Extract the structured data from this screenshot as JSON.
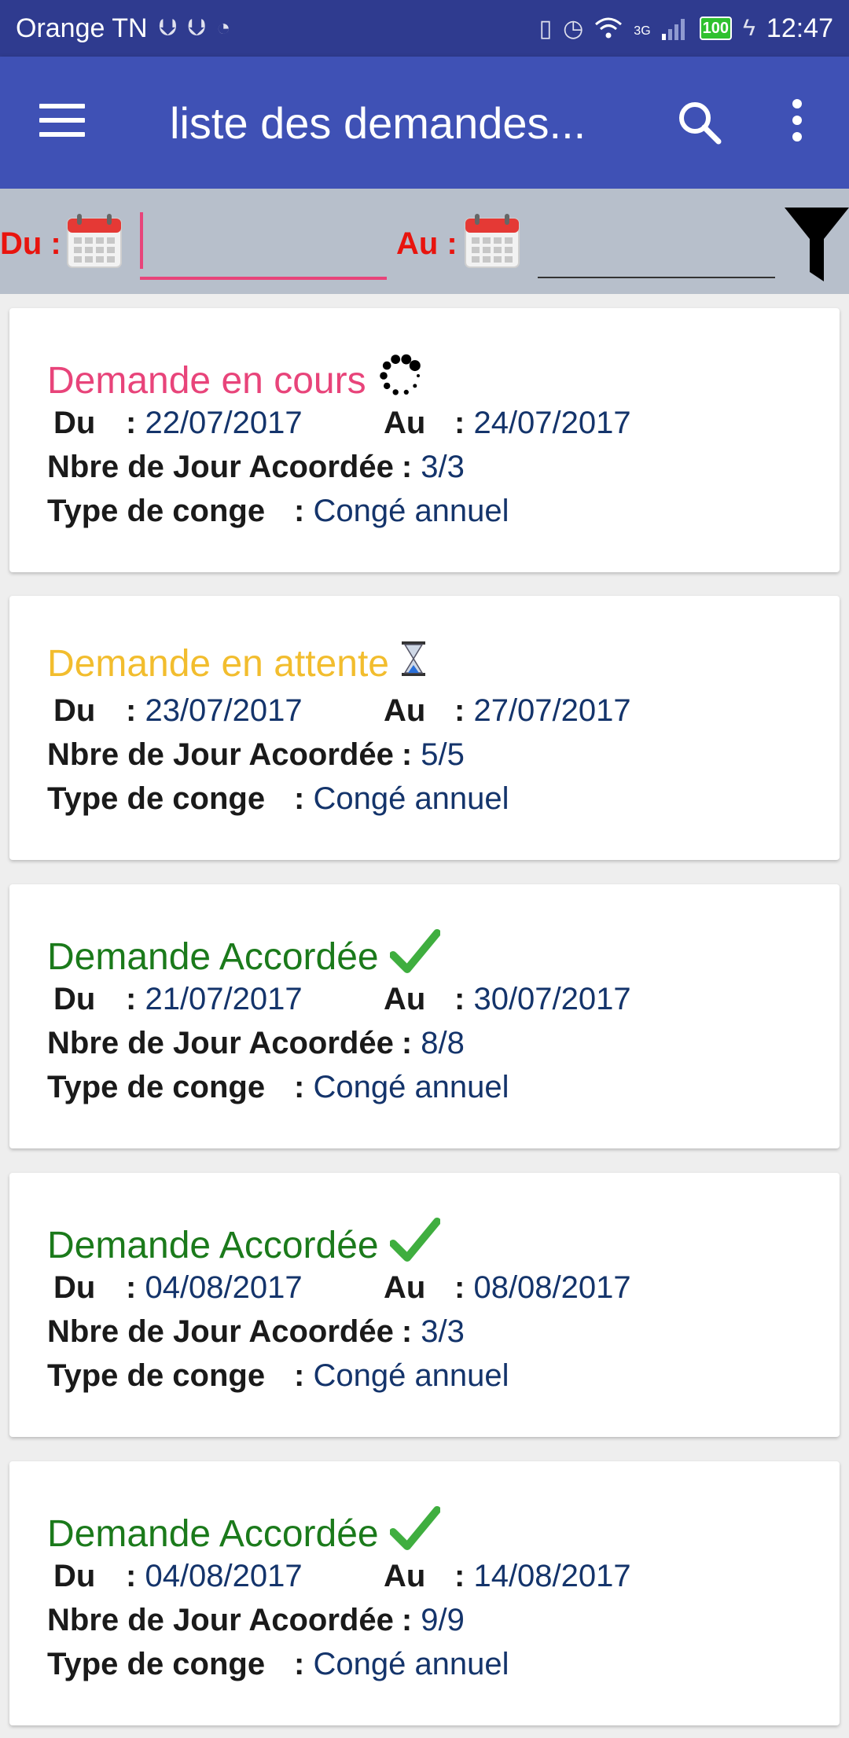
{
  "status_bar": {
    "carrier": "Orange TN",
    "network": "3G",
    "battery": "100",
    "time": "12:47"
  },
  "app_bar": {
    "title": "liste des demandes..."
  },
  "filter": {
    "from_label": "Du :",
    "to_label": "Au :",
    "from_value": "",
    "to_value": ""
  },
  "labels": {
    "du": "Du",
    "au": "Au",
    "colon": ":",
    "nbre": "Nbre de Jour Acoordée",
    "type": "Type de conge"
  },
  "requests": [
    {
      "status": "Demande en cours",
      "status_icon": "loading-spinner-icon",
      "status_color": "#e8447a",
      "du": "22/07/2017",
      "au": "24/07/2017",
      "jours": "3/3",
      "type": "Congé annuel"
    },
    {
      "status": "Demande en attente",
      "status_icon": "hourglass-icon",
      "status_color": "#f2bd2e",
      "du": "23/07/2017",
      "au": "27/07/2017",
      "jours": "5/5",
      "type": "Congé annuel"
    },
    {
      "status": "Demande Accordée",
      "status_icon": "checkmark-icon",
      "status_color": "#1b7a1b",
      "du": "21/07/2017",
      "au": "30/07/2017",
      "jours": "8/8",
      "type": "Congé annuel"
    },
    {
      "status": "Demande Accordée",
      "status_icon": "checkmark-icon",
      "status_color": "#1b7a1b",
      "du": "04/08/2017",
      "au": "08/08/2017",
      "jours": "3/3",
      "type": "Congé annuel"
    },
    {
      "status": "Demande Accordée",
      "status_icon": "checkmark-icon",
      "status_color": "#1b7a1b",
      "du": "04/08/2017",
      "au": "14/08/2017",
      "jours": "9/9",
      "type": "Congé annuel"
    }
  ]
}
